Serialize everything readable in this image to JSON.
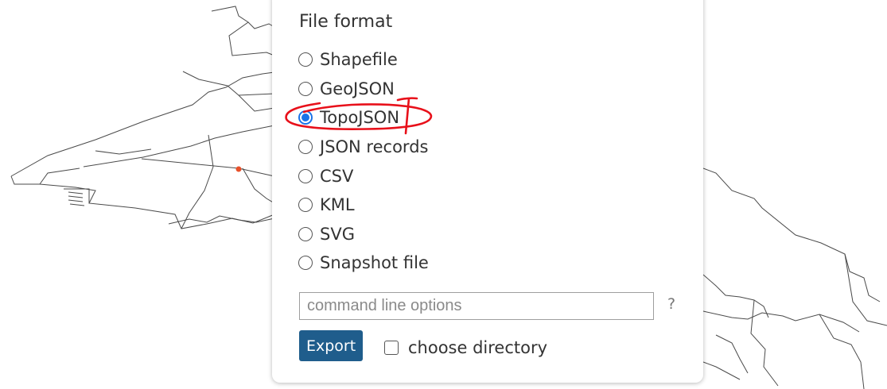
{
  "export_dialog": {
    "title": "File format",
    "formats": [
      {
        "label": "Shapefile",
        "selected": false
      },
      {
        "label": "GeoJSON",
        "selected": false
      },
      {
        "label": "TopoJSON",
        "selected": true
      },
      {
        "label": "JSON records",
        "selected": false
      },
      {
        "label": "CSV",
        "selected": false
      },
      {
        "label": "KML",
        "selected": false
      },
      {
        "label": "SVG",
        "selected": false
      },
      {
        "label": "Snapshot file",
        "selected": false
      }
    ],
    "command_input": {
      "placeholder": "command line options",
      "value": ""
    },
    "help_label": "?",
    "export_button_label": "Export",
    "choose_directory_label": "choose directory",
    "choose_directory_checked": false
  },
  "colors": {
    "radio_selected": "#1a73e8",
    "export_button": "#1f5d8c",
    "annotation": "#e8101a",
    "map_point": "#e8502a"
  }
}
